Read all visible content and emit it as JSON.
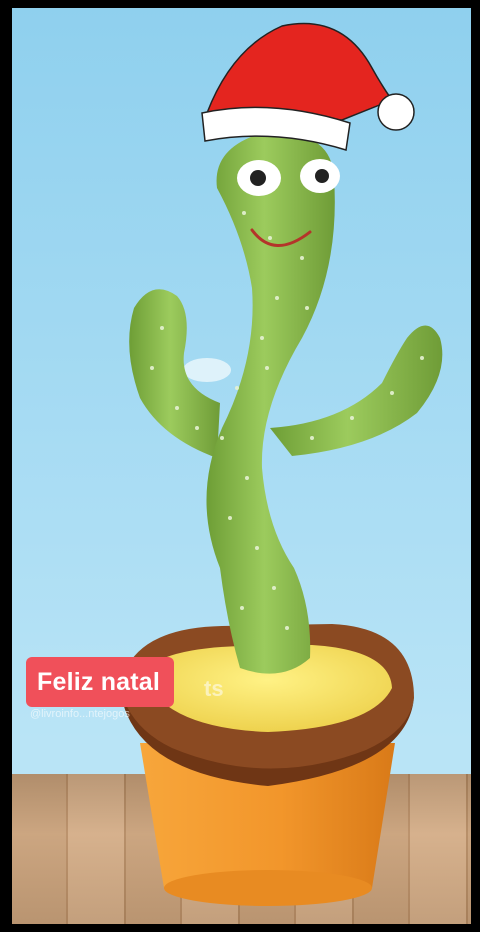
{
  "caption": {
    "text": "Feliz natal",
    "overflow": "ts"
  },
  "watermark": {
    "handle": "@livroinfo...ntejogos"
  },
  "colors": {
    "sky": "#a6dbf3",
    "cactus": "#8cbd4f",
    "hat": "#e4251f",
    "pot": "#f39a2c",
    "soil": "#f7e66a",
    "banner": "#f0505a"
  }
}
